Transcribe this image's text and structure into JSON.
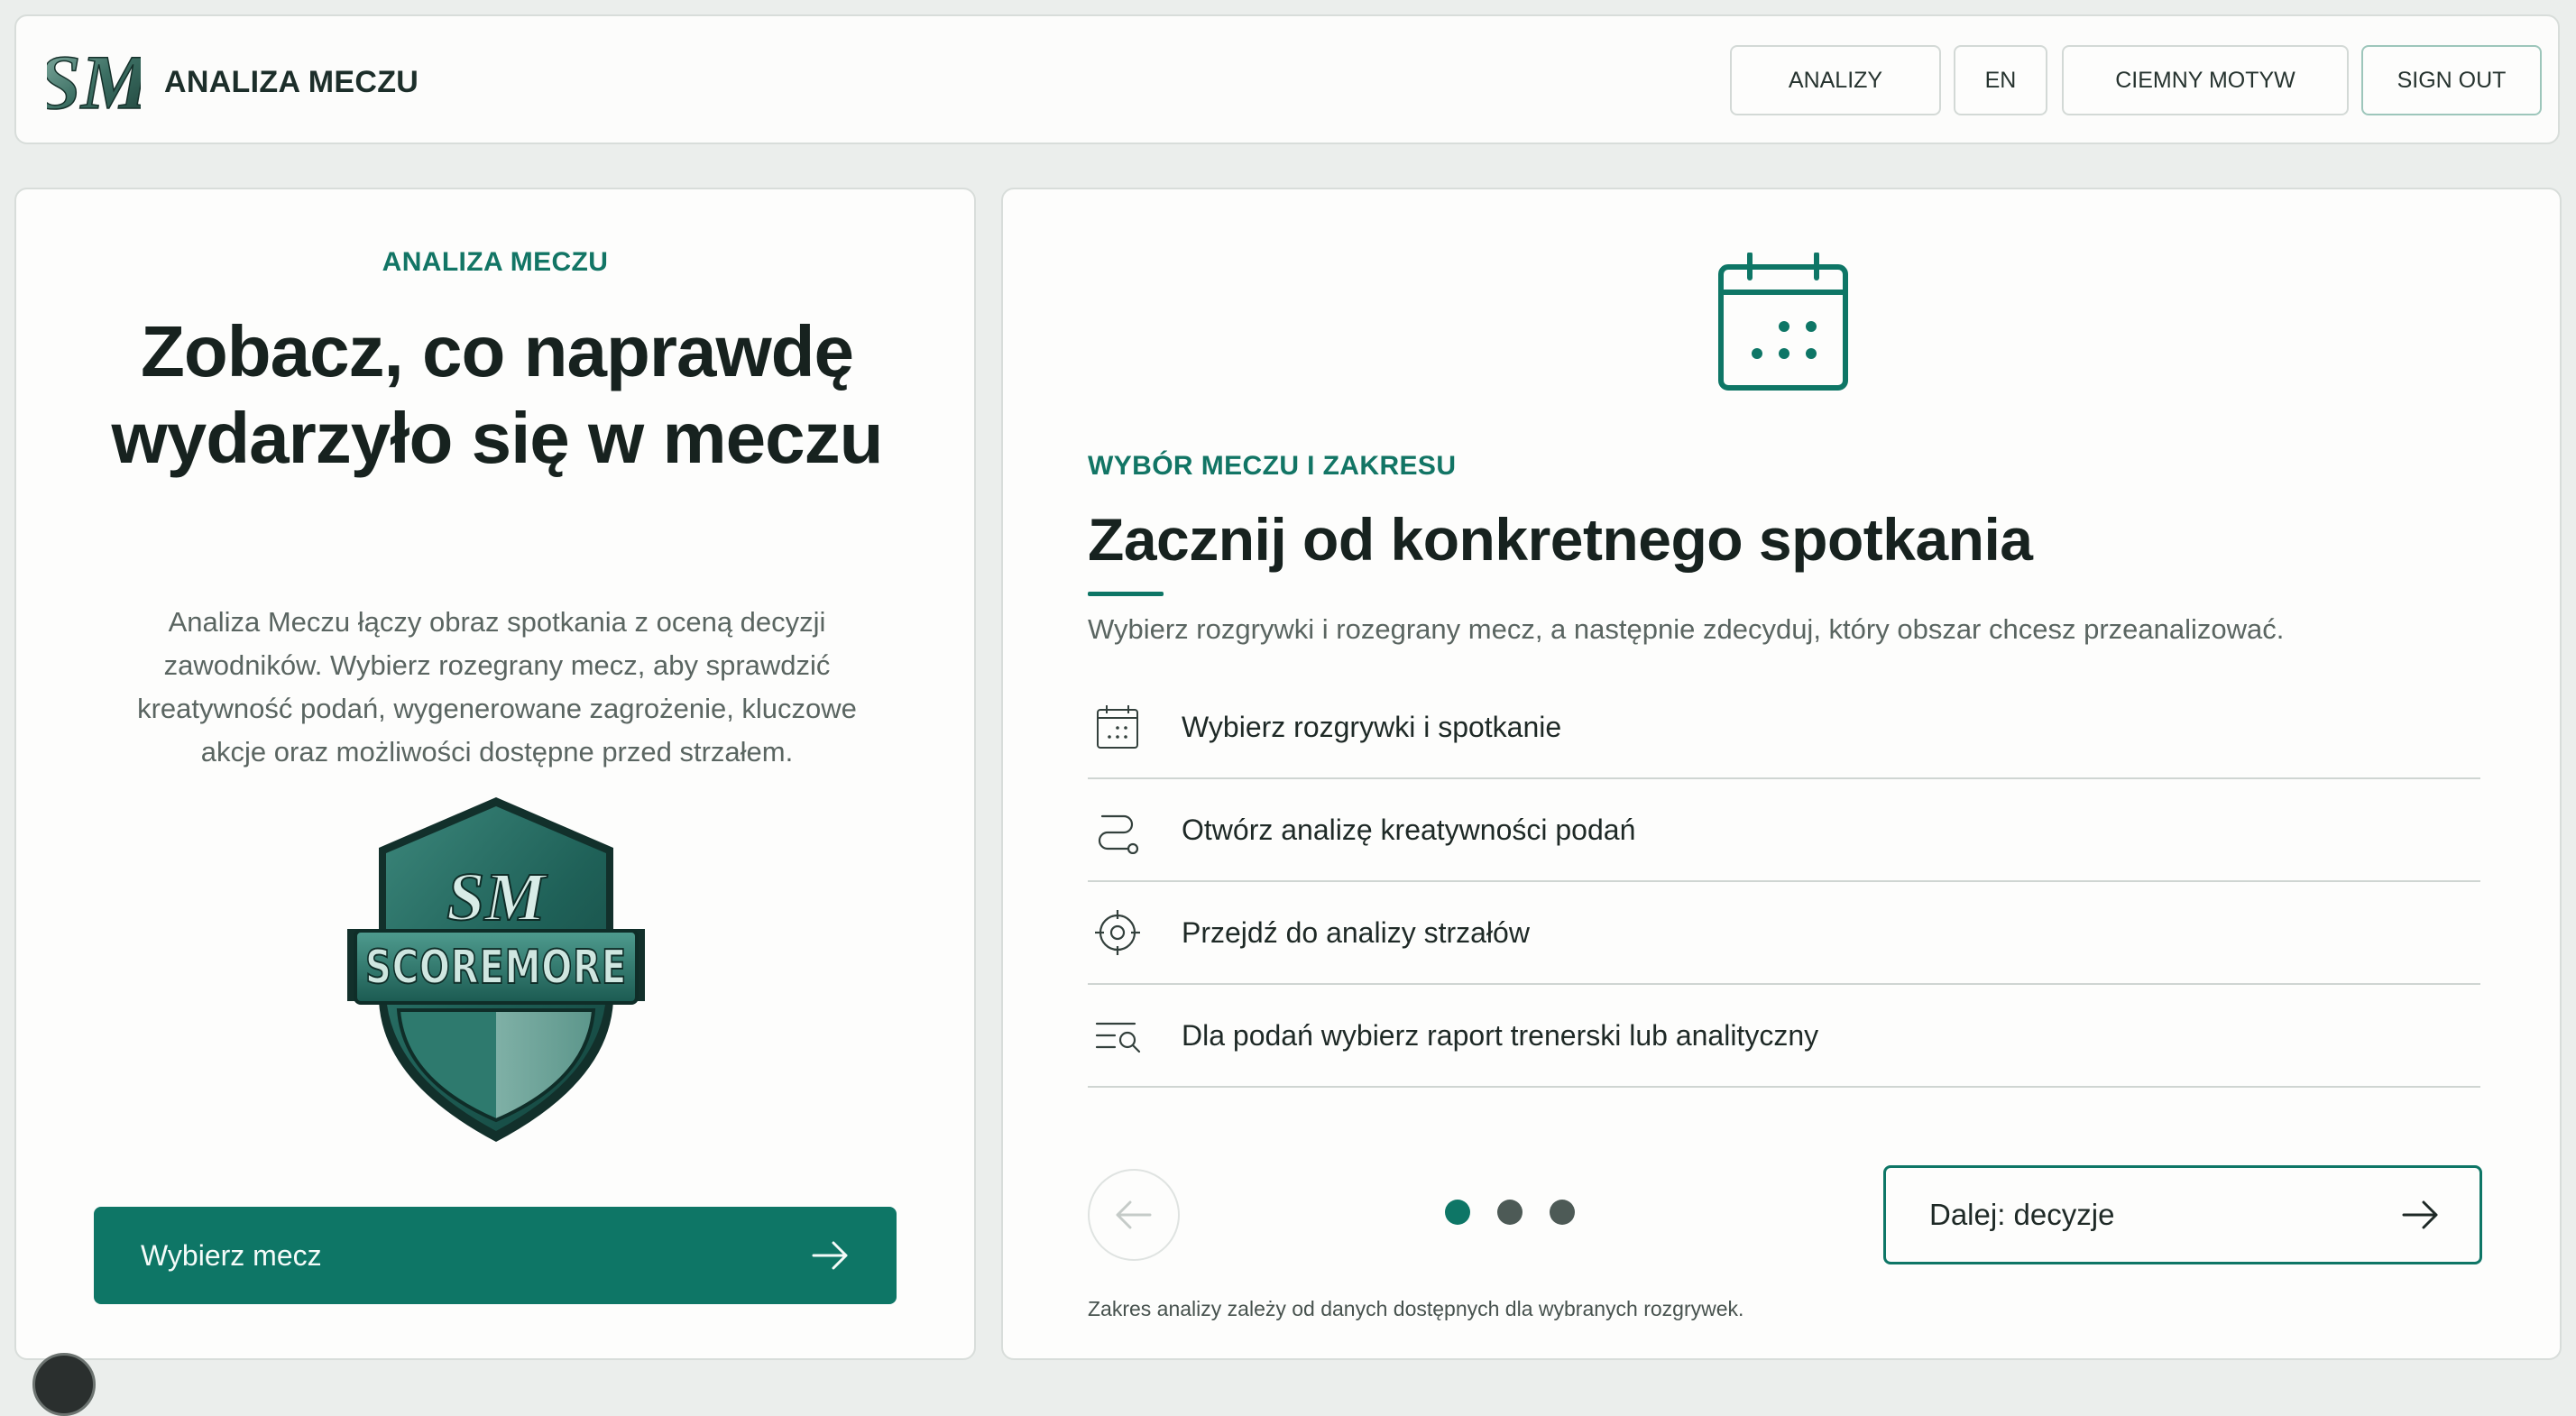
{
  "header": {
    "brand_name": "ANALIZA MECZU",
    "logo_text": "SM",
    "nav": {
      "analyses": "ANALIZY",
      "language": "EN",
      "theme": "CIEMNY MOTYW",
      "sign_out": "SIGN OUT"
    }
  },
  "hero": {
    "eyebrow": "ANALIZA MECZU",
    "title": "Zobacz, co naprawdę wydarzyło się w meczu",
    "description": "Analiza Meczu łączy obraz spotkania z oceną decyzji zawodników. Wybierz rozegrany mecz, aby sprawdzić kreatywność podań, wygenerowane zagrożenie, kluczowe akcje oraz możliwości dostępne przed strzałem.",
    "badge_text": "SCOREMORE",
    "badge_monogram": "SM",
    "cta_label": "Wybierz mecz"
  },
  "onboarding": {
    "eyebrow": "WYBÓR MECZU I ZAKRESU",
    "title": "Zacznij od konkretnego spotkania",
    "description": "Wybierz rozgrywki i rozegrany mecz, a następnie zdecyduj, który obszar chcesz przeanalizować.",
    "steps": [
      {
        "icon": "calendar-icon",
        "label": "Wybierz rozgrywki i spotkanie"
      },
      {
        "icon": "route-icon",
        "label": "Otwórz analizę kreatywności podań"
      },
      {
        "icon": "target-icon",
        "label": "Przejdź do analizy strzałów"
      },
      {
        "icon": "report-search-icon",
        "label": "Dla podań wybierz raport trenerski lub analityczny"
      }
    ],
    "pagination": {
      "current": 1,
      "total": 3
    },
    "next_label": "Dalej: decyzje",
    "footnote": "Zakres analizy zależy od danych dostępnych dla wybranych rozgrywek."
  },
  "colors": {
    "accent": "#0e7666",
    "background": "#ebeeec",
    "panel": "#fdfdfc",
    "text": "#17221f",
    "muted": "#5a6561"
  }
}
